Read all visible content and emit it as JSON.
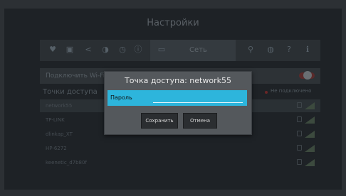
{
  "screen": {
    "title": "Настройки"
  },
  "toolbar": {
    "icons": [
      "heart-icon",
      "grid-icon",
      "share-icon",
      "contrast-icon",
      "clock-icon",
      "tv-icon",
      "pin-icon",
      "globe-icon",
      "help-icon",
      "info-icon"
    ],
    "active_label": "Сеть"
  },
  "wifi": {
    "label": "Подключить Wi-Fi"
  },
  "networks_section": {
    "header": "Точки доступа",
    "right_label": "Не подключено"
  },
  "networks": [
    {
      "name": "network55"
    },
    {
      "name": "TP-LINK"
    },
    {
      "name": "dlinkap_XT"
    },
    {
      "name": "HP-6272"
    },
    {
      "name": "keenetic_d7b80f"
    }
  ],
  "dialog": {
    "title": "Точка доступа: network55",
    "password_label": "Пароль",
    "save_label": "Сохранить",
    "cancel_label": "Отмена"
  },
  "colors": {
    "accent": "#2db5dc",
    "dialog_bg": "#54585c",
    "screen_bg": "#1e2226"
  }
}
